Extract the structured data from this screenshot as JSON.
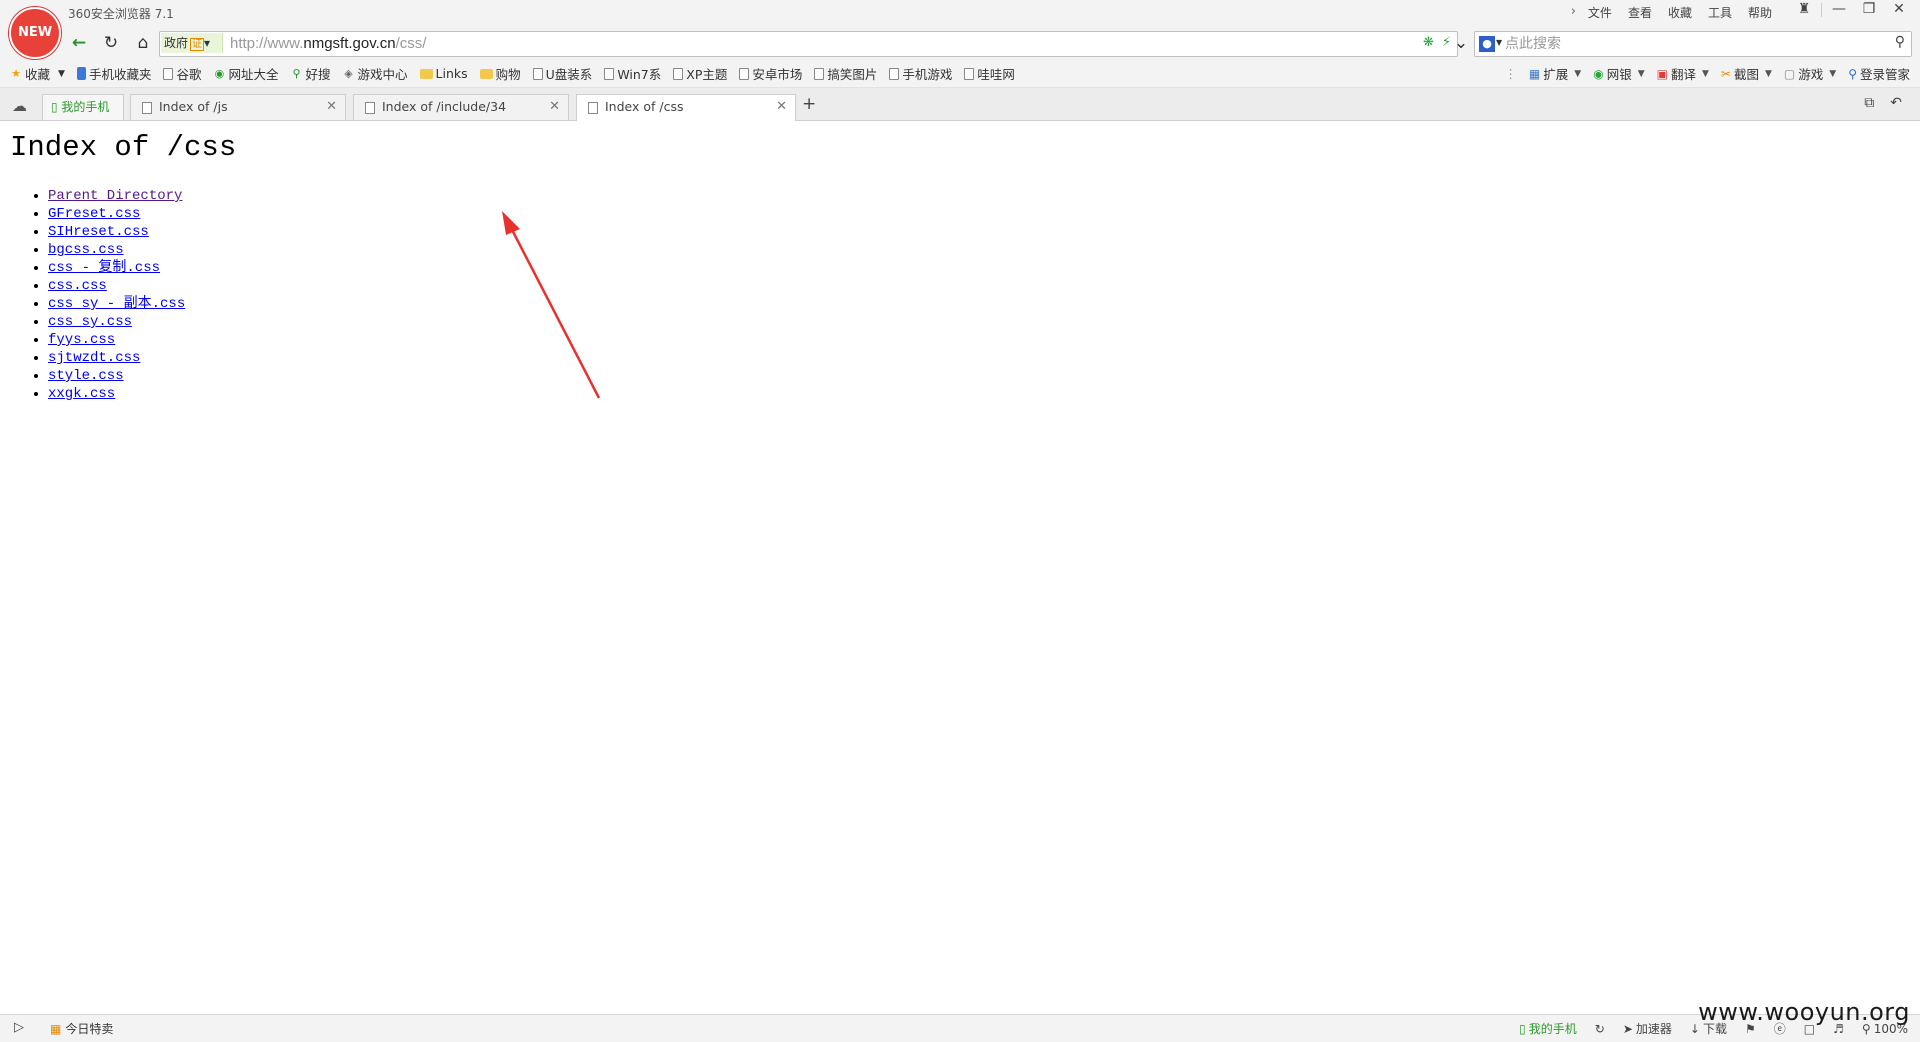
{
  "browser": {
    "logo_text": "NEW",
    "app_title": "360安全浏览器 7.1",
    "menu": [
      "文件",
      "查看",
      "收藏",
      "工具",
      "帮助"
    ],
    "window_controls": [
      "shirt-icon",
      "minimize-icon",
      "restore-icon",
      "close-icon"
    ]
  },
  "address_bar": {
    "gov_label": "政府",
    "cert_label": "证",
    "url_prefix": "http://www.",
    "url_host": "nmgsft.gov.cn",
    "url_path": "/css/",
    "search_placeholder": "点此搜索"
  },
  "favorites": {
    "items": [
      {
        "label": "收藏",
        "icon": "star-icon"
      },
      {
        "label": "手机收藏夹",
        "icon": "phone-icon"
      },
      {
        "label": "谷歌",
        "icon": "page-icon"
      },
      {
        "label": "网址大全",
        "icon": "globe-icon"
      },
      {
        "label": "好搜",
        "icon": "search-icon"
      },
      {
        "label": "游戏中心",
        "icon": "gamepad-icon"
      },
      {
        "label": "Links",
        "icon": "folder-icon"
      },
      {
        "label": "购物",
        "icon": "folder-icon"
      },
      {
        "label": "U盘装系",
        "icon": "page-icon"
      },
      {
        "label": "Win7系",
        "icon": "page-icon"
      },
      {
        "label": "XP主题",
        "icon": "page-icon"
      },
      {
        "label": "安卓市场",
        "icon": "page-icon"
      },
      {
        "label": "搞笑图片",
        "icon": "page-icon"
      },
      {
        "label": "手机游戏",
        "icon": "page-icon"
      },
      {
        "label": "哇哇网",
        "icon": "page-icon"
      }
    ],
    "tools": [
      {
        "label": "扩展",
        "icon": "extension-icon"
      },
      {
        "label": "网银",
        "icon": "bank-icon"
      },
      {
        "label": "翻译",
        "icon": "translate-icon"
      },
      {
        "label": "截图",
        "icon": "screenshot-icon"
      },
      {
        "label": "游戏",
        "icon": "game-icon"
      },
      {
        "label": "登录管家",
        "icon": "login-manager-icon"
      }
    ]
  },
  "tabs": {
    "phone_tab": "我的手机",
    "items": [
      {
        "title": "Index of /js",
        "active": false
      },
      {
        "title": "Index of /include/34",
        "active": false
      },
      {
        "title": "Index of /css",
        "active": true
      }
    ],
    "new_tab": "+"
  },
  "page": {
    "heading": "Index of /css",
    "files": [
      {
        "name": "Parent Directory",
        "visited": true
      },
      {
        "name": "GFreset.css",
        "visited": false
      },
      {
        "name": "SIHreset.css",
        "visited": false
      },
      {
        "name": "bgcss.css",
        "visited": false
      },
      {
        "name": "css - 复制.css",
        "visited": false
      },
      {
        "name": "css.css",
        "visited": false
      },
      {
        "name": "css_sy - 副本.css",
        "visited": false
      },
      {
        "name": "css_sy.css",
        "visited": false
      },
      {
        "name": "fyys.css",
        "visited": false
      },
      {
        "name": "sjtwzdt.css",
        "visited": false
      },
      {
        "name": "style.css",
        "visited": false
      },
      {
        "name": "xxgk.css",
        "visited": false
      }
    ],
    "annotation_color": "#e8312f"
  },
  "statusbar": {
    "deal_label": "今日特卖",
    "phone_label": "我的手机",
    "accelerator_label": "加速器",
    "download_label": "下载",
    "zoom": "100%"
  },
  "watermark": "www.wooyun.org"
}
